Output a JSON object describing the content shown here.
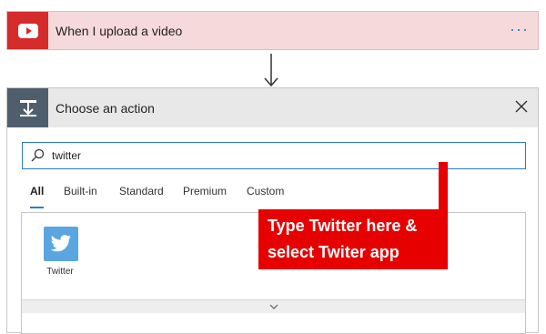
{
  "trigger": {
    "title": "When I upload a video",
    "icon": "youtube-icon",
    "more": "···",
    "color": "#d52b2b"
  },
  "action": {
    "title": "Choose an action",
    "icon": "action-icon",
    "search": {
      "value": "twitter",
      "placeholder": ""
    },
    "tabs": [
      {
        "label": "All",
        "active": true
      },
      {
        "label": "Built-in"
      },
      {
        "label": "Standard"
      },
      {
        "label": "Premium"
      },
      {
        "label": "Custom"
      }
    ],
    "results": [
      {
        "label": "Twitter",
        "icon": "twitter-icon",
        "color": "#5aa6e0"
      }
    ]
  },
  "annotation": {
    "line1": "Type Twitter here &",
    "line2": "select Twiter app",
    "color": "#e60000"
  }
}
